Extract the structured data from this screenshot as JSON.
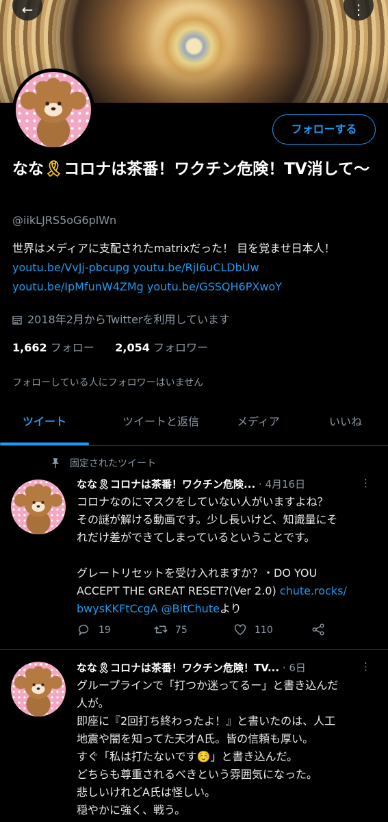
{
  "profile": {
    "name_prefix": "なな",
    "ribbon": "🎗",
    "name_rest": "コロナは茶番！ワクチン危険！TV消して〜",
    "handle": "@iikLJRS5oG6plWn",
    "bio_text": "世界はメディアに支配されたmatrixだった！ 目を覚ませ日本人！ ",
    "bio_links": [
      "youtu.be/VvJj-pbcupg",
      "youtu.be/RjI6uCLDbUw",
      "youtu.be/IpMfunW4ZMg",
      "youtu.be/GSSQH6PXwoY"
    ],
    "joined": "2018年2月からTwitterを利用しています",
    "following_count": "1,662",
    "following_label": "フォロー",
    "followers_count": "2,054",
    "followers_label": "フォロワー",
    "no_mutual": "フォローしている人にフォロワーはいません",
    "follow_button": "フォローする"
  },
  "tabs": [
    "ツイート",
    "ツイートと返信",
    "メディア",
    "いいね"
  ],
  "pinned_label": "固定されたツイート",
  "tweets": [
    {
      "display_name": "なな🎗コロナは茶番！ワクチン危険...",
      "date": "· 4月16日",
      "lines": [
        "コロナなのにマスクをしていない人がいますよね？",
        "その謎が解ける動画です。少し長いけど、知識量にそ",
        "れだけ差ができてしまっているということです。",
        "",
        "グレートリセットを受け入れますか？・DO YOU",
        "ACCEPT THE GREAT RESET?(Ver 2.0) "
      ],
      "link1": "chute.rocks/",
      "link2": "bwysKKFtCcgA",
      "mention": "@BitChute",
      "suffix": "より",
      "replies": "19",
      "retweets": "75",
      "likes": "110"
    },
    {
      "display_name": "なな🎗コロナは茶番！ワクチン危険！TV...",
      "date": "· 6日",
      "lines": [
        "グループラインで「打つか迷ってるー」と書き込んだ",
        "人が。",
        "即座に『2回打ち終わったよ！』と書いたのは、人工",
        "地震や闇を知ってた天才A氏。皆の信頼も厚い。",
        "すぐ「私は打たないです☺️」と書き込んだ。",
        "どちらも尊重されるべきという雰囲気になった。",
        "悲しいけれどA氏は怪しい。",
        "穏やかに強く、戦う。"
      ]
    }
  ],
  "colors": {
    "accent": "#1d9bf0",
    "muted": "#8b98a5",
    "ribbon": "#f2c230"
  }
}
